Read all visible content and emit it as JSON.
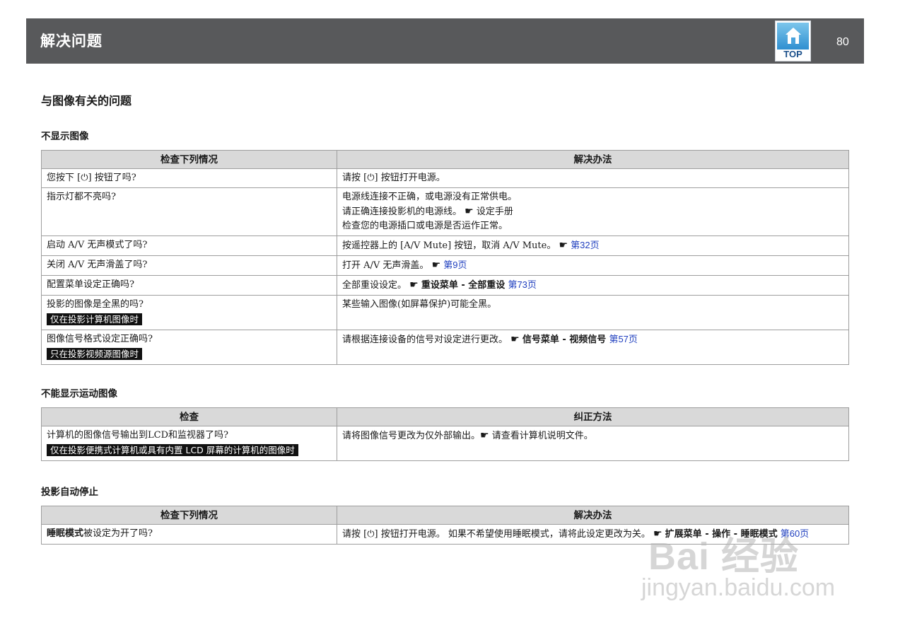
{
  "header": {
    "title": "解决问题",
    "top_label": "TOP",
    "page_number": "80",
    "bar_color": "#58595b"
  },
  "section_title": "与图像有关的问题",
  "sections": [
    {
      "title": "不显示图像",
      "col_check": "检查下列情况",
      "col_fix": "解决办法",
      "rows": [
        {
          "check": "您按下 [⏻] 按钮了吗?",
          "fix": "请按 [⏻] 按钮打开电源。"
        },
        {
          "check": "指示灯都不亮吗?",
          "fix_line1": "电源线连接不正确，或电源没有正常供电。",
          "fix_line2": "请正确连接投影机的电源线。",
          "fix_line2_ref": "设定手册",
          "fix_line3": "检查您的电源插口或电源是否运作正常。"
        },
        {
          "check": "启动 A/V 无声模式了吗?",
          "fix": "按遥控器上的 [A/V Mute] 按钮，取消 A/V Mute。",
          "link": "第32页"
        },
        {
          "check": "关闭 A/V 无声滑盖了吗?",
          "fix": "打开 A/V 无声滑盖。",
          "link": "第9页"
        },
        {
          "check": "配置菜单设定正确吗?",
          "fix": "全部重设设定。",
          "ref": "重设菜单 - 全部重设",
          "link": "第73页"
        },
        {
          "check": "投影的图像是全黑的吗?",
          "tag": "仅在投影计算机图像时",
          "fix": "某些输入图像(如屏幕保护)可能全黑。"
        },
        {
          "check": "图像信号格式设定正确吗?",
          "tag": "只在投影视频源图像时",
          "fix": "请根据连接设备的信号对设定进行更改。",
          "ref": "信号菜单 - 视频信号",
          "link": "第57页"
        }
      ]
    },
    {
      "title": "不能显示运动图像",
      "col_check": "检查",
      "col_fix": "纠正方法",
      "rows": [
        {
          "check": "计算机的图像信号输出到LCD和监视器了吗?",
          "tag": "仅在投影便携式计算机或具有内置 LCD 屏幕的计算机的图像时",
          "fix": "请将图像信号更改为仅外部输出。",
          "fix_after": "请查看计算机说明文件。"
        }
      ]
    },
    {
      "title": "投影自动停止",
      "col_check": "检查下列情况",
      "col_fix": "解决办法",
      "rows": [
        {
          "check_bold": "睡眠模式",
          "check": "被设定为开了吗?",
          "fix": "请按 [⏻] 按钮打开电源。 如果不希望使用睡眠模式，请将此设定更改为关。",
          "ref": "扩展菜单 - 操作 - 睡眠模式",
          "link": "第60页"
        }
      ]
    }
  ],
  "watermark": {
    "brand": "Bai 经验",
    "site": "jingyan.baidu.com"
  },
  "colors": {
    "header_bg": "#58595b",
    "table_header_bg": "#d9d9d9",
    "link": "#1f3fbf",
    "tag_bg": "#111111"
  },
  "icons": [
    "top-home-icon",
    "pointing-hand-icon"
  ]
}
